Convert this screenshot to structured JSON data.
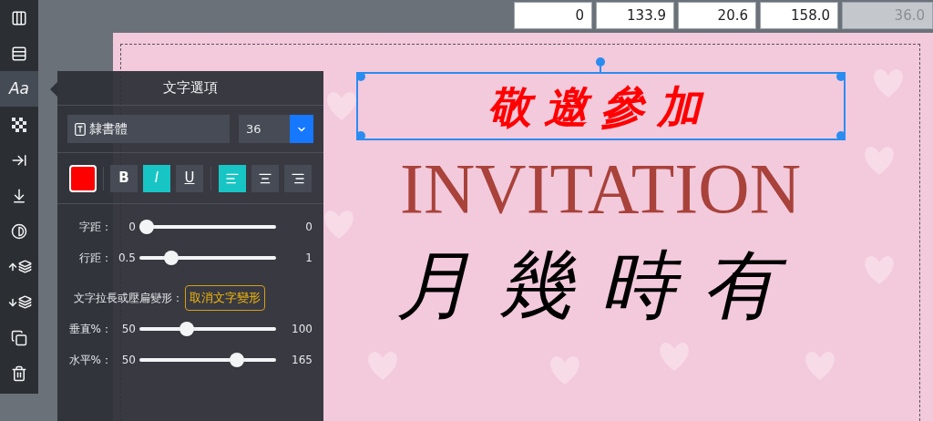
{
  "toolbar": [
    {
      "kind": "columns",
      "selected": false
    },
    {
      "kind": "rows",
      "selected": false
    },
    {
      "kind": "text",
      "label": "Aa",
      "selected": true
    },
    {
      "kind": "checker",
      "selected": false
    },
    {
      "kind": "indent",
      "selected": false
    },
    {
      "kind": "bottom",
      "selected": false
    },
    {
      "kind": "contrast",
      "selected": false
    },
    {
      "kind": "raise",
      "selected": false
    },
    {
      "kind": "lower",
      "selected": false
    },
    {
      "kind": "copy",
      "selected": false
    },
    {
      "kind": "trash",
      "selected": false
    }
  ],
  "coordinates": [
    {
      "value": "0",
      "disabled": false
    },
    {
      "value": "133.9",
      "disabled": false
    },
    {
      "value": "20.6",
      "disabled": false
    },
    {
      "value": "158.0",
      "disabled": false
    },
    {
      "value": "36.0",
      "disabled": true
    }
  ],
  "text_panel": {
    "title": "文字選項",
    "font": "隸書體",
    "size": "36",
    "color": "#ff0000",
    "styles": [
      {
        "kind": "bold",
        "label": "B",
        "selected": false
      },
      {
        "kind": "italic",
        "label": "I",
        "selected": true
      },
      {
        "kind": "underline",
        "label": "U",
        "selected": false
      }
    ],
    "alignments": [
      {
        "kind": "left",
        "selected": true
      },
      {
        "kind": "center",
        "selected": false
      },
      {
        "kind": "right",
        "selected": false
      }
    ],
    "spacing_sliders": [
      {
        "label": "字距：",
        "min": "0",
        "max": "0",
        "level": 0
      },
      {
        "label": "行距：",
        "min": "0.5",
        "max": "1",
        "level": 0.2
      }
    ],
    "transform_label": "文字拉長或壓扁變形：",
    "transform_button": "取消文字變形",
    "scale_sliders": [
      {
        "label": "垂直%：",
        "min": "50",
        "max": "100",
        "level": 0.33
      },
      {
        "label": "水平%：",
        "min": "50",
        "max": "165",
        "level": 0.74
      }
    ]
  },
  "card": {
    "selected_text": "敬邀參加",
    "title": "INVITATION",
    "calligraphy": "月幾時有"
  }
}
